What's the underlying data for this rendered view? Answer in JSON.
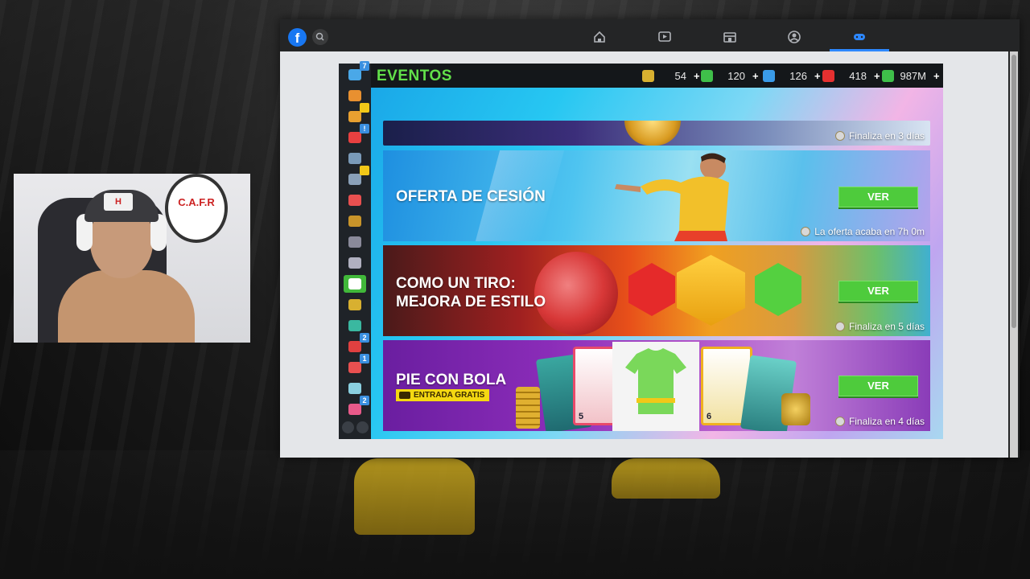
{
  "browser": {
    "logo": "f",
    "nav_icons": [
      "home-icon",
      "video-icon",
      "marketplace-icon",
      "groups-icon",
      "gaming-icon"
    ],
    "accent": "#2d88ff"
  },
  "webcam": {
    "cap_text": "H",
    "wall_sign": "C.A.F.R"
  },
  "game": {
    "title": "EVENTOS",
    "currencies": [
      {
        "icon": "token-icon",
        "value": "54",
        "color": "#d8b030"
      },
      {
        "icon": "cash-icon",
        "value": "120",
        "color": "#3fbf4a"
      },
      {
        "icon": "energy-icon",
        "value": "126",
        "color": "#3a9be8"
      },
      {
        "icon": "medic-icon",
        "value": "418",
        "color": "#e53030"
      },
      {
        "icon": "money-icon",
        "value": "987M",
        "color": "#3fbf4a"
      }
    ],
    "sidebar": [
      {
        "icon": "globe-icon",
        "badge": "7"
      },
      {
        "icon": "box-icon",
        "badge": ""
      },
      {
        "icon": "cone-icon",
        "badge": "gift"
      },
      {
        "icon": "transfer-icon",
        "badge": "!"
      },
      {
        "icon": "stadium-icon",
        "badge": ""
      },
      {
        "icon": "screen-icon",
        "badge": "gift"
      },
      {
        "icon": "calendar-icon",
        "badge": ""
      },
      {
        "icon": "trophy-icon",
        "badge": ""
      },
      {
        "icon": "cup-icon",
        "badge": ""
      },
      {
        "icon": "league-icon",
        "badge": ""
      },
      {
        "icon": "ball-icon",
        "badge": "",
        "active": true
      },
      {
        "icon": "team-icon",
        "badge": ""
      },
      {
        "icon": "shield-icon",
        "badge": ""
      },
      {
        "icon": "tactics-icon",
        "badge": "2"
      },
      {
        "icon": "stats-icon",
        "badge": "1"
      },
      {
        "icon": "piggy-icon",
        "badge": ""
      },
      {
        "icon": "shop-icon",
        "badge": "2"
      }
    ],
    "events": [
      {
        "title": "",
        "footer": "Finaliza en 3 días",
        "button": ""
      },
      {
        "title": "OFERTA DE CESIÓN",
        "footer": "La oferta acaba en 7h 0m",
        "button": "VER"
      },
      {
        "title_line1": "COMO UN TIRO:",
        "title_line2": "MEJORA DE ESTILO",
        "footer": "Finaliza en 5 días",
        "button": "VER"
      },
      {
        "title": "PIE CON BOLA",
        "tag": "ENTRADA GRATIS",
        "footer": "Finaliza en 4 días",
        "button": "VER"
      }
    ],
    "card_numbers": [
      "5",
      "6"
    ]
  }
}
